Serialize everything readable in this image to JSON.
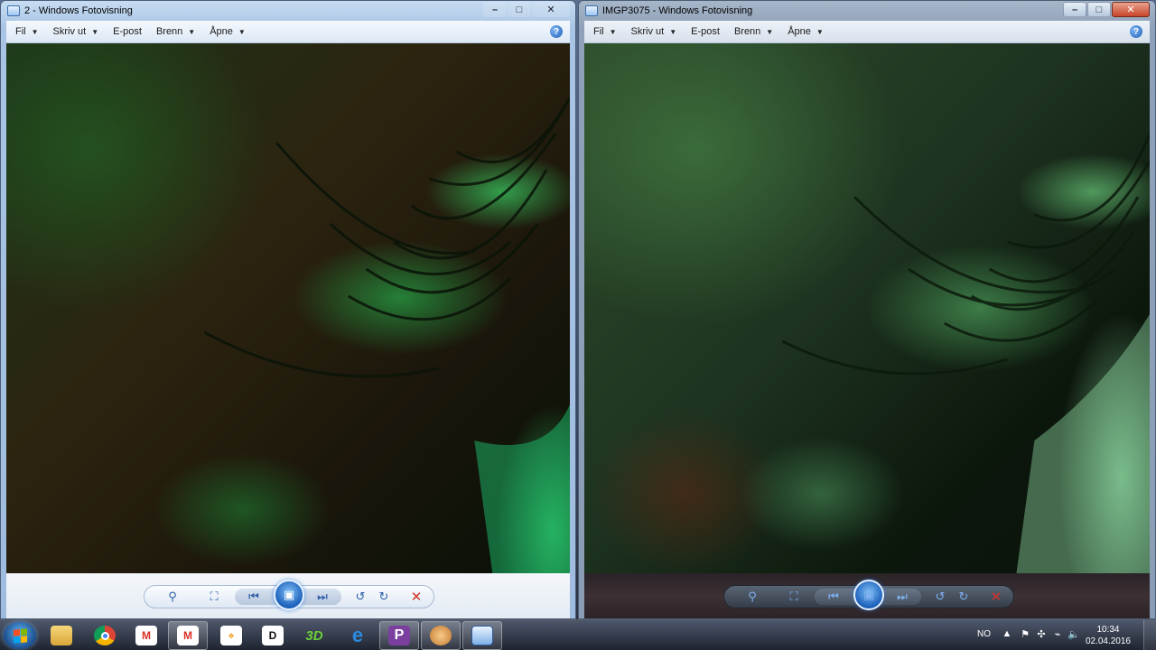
{
  "windows": [
    {
      "title": "2 - Windows Fotovisning",
      "menu": [
        "Fil",
        "Skriv ut",
        "E-post",
        "Brenn",
        "Åpne"
      ]
    },
    {
      "title": "IMGP3075 - Windows Fotovisning",
      "menu": [
        "Fil",
        "Skriv ut",
        "E-post",
        "Brenn",
        "Åpne"
      ]
    }
  ],
  "menu_arrows": {
    "fil": true,
    "skriv_ut": true,
    "e_post": false,
    "brenn": true,
    "apne": true
  },
  "help_glyph": "?",
  "caption_glyphs": {
    "minimize": "–",
    "maximize": "□",
    "close": "✕"
  },
  "viewer_controls": {
    "zoom_glyph": "⚲",
    "fit_glyph": "⛶",
    "prev_glyph": "⏮",
    "slideshow_glyph": "▣",
    "next_glyph": "⏭",
    "rotate_left_glyph": "↺",
    "rotate_right_glyph": "↻",
    "delete_glyph": "✕"
  },
  "taskbar": {
    "apps": [
      {
        "name": "file-explorer"
      },
      {
        "name": "chrome"
      },
      {
        "name": "gmail"
      },
      {
        "name": "gmail-active"
      },
      {
        "name": "app-yellow"
      },
      {
        "name": "app-d",
        "label": "D"
      },
      {
        "name": "app-3d",
        "label": "3D"
      },
      {
        "name": "internet-explorer",
        "label": "e"
      },
      {
        "name": "app-p",
        "label": "P"
      },
      {
        "name": "app-monkey"
      },
      {
        "name": "photo-viewer"
      }
    ]
  },
  "tray": {
    "language": "NO",
    "time": "10:34",
    "date": "02.04.2016"
  },
  "colors": {
    "accent_blue": "#1b5fb9",
    "delete_red": "#d2322b"
  }
}
